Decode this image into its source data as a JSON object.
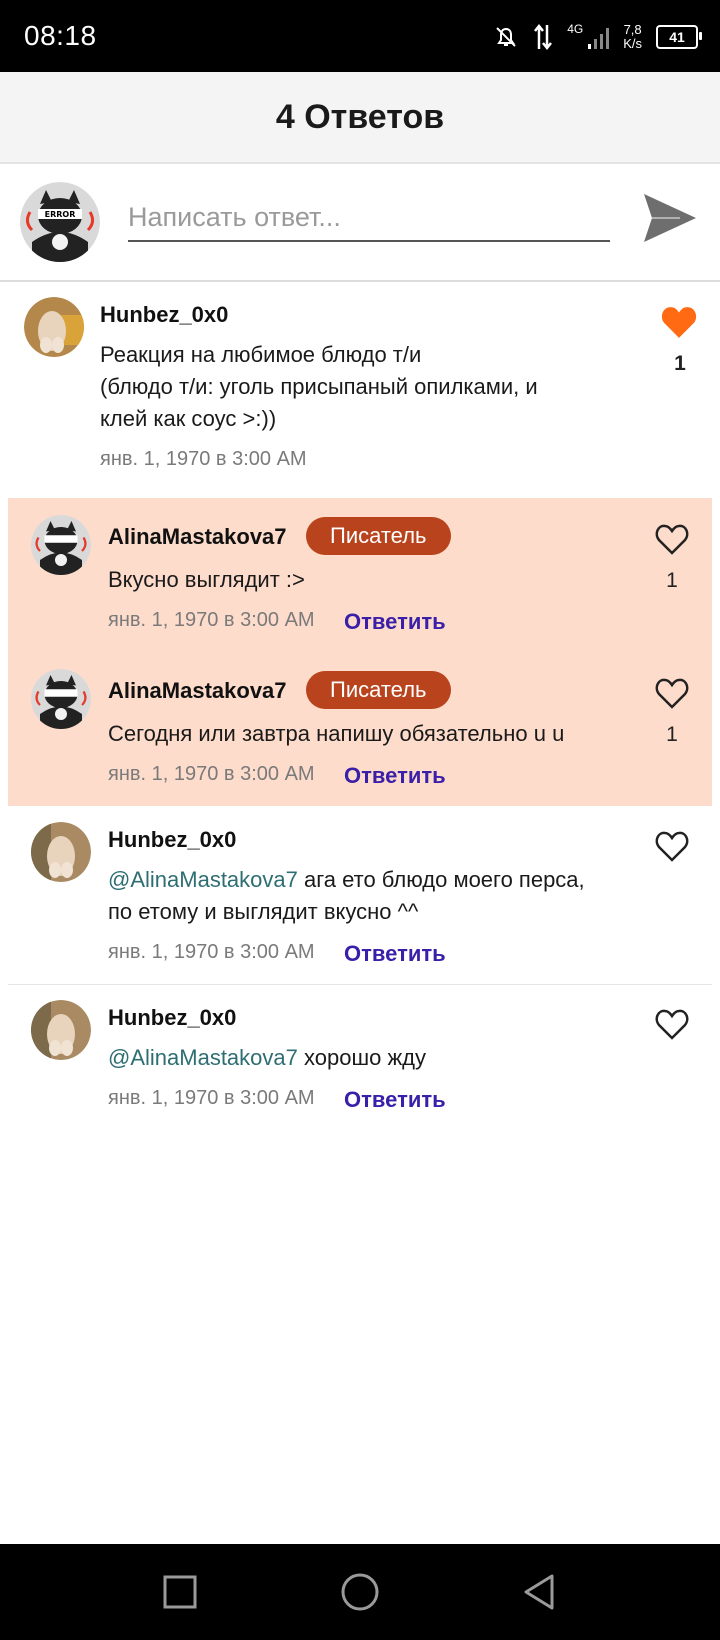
{
  "status_bar": {
    "time": "08:18",
    "network": "4G",
    "speed_value": "7,8",
    "speed_unit": "K/s",
    "battery": "41"
  },
  "header": {
    "title": "4 Ответов"
  },
  "composer": {
    "placeholder": "Написать ответ..."
  },
  "comments": [
    {
      "username": "Hunbez_0x0",
      "text_line1": "Реакция на любимое блюдо т/и",
      "text_line2": "(блюдо т/и: уголь присыпаный опилками, и",
      "text_line3": "клей как соус >:))",
      "date": "янв. 1, 1970 в 3:00 AM",
      "likes": "1",
      "liked": true
    },
    {
      "username": "AlinaMastakova7",
      "badge": "Писатель",
      "text": "Вкусно выглядит :>",
      "date": "янв. 1, 1970 в 3:00 AM",
      "reply_label": "Ответить",
      "likes": "1"
    },
    {
      "username": "AlinaMastakova7",
      "badge": "Писатель",
      "text": "Сегодня или завтра напишу обязательно u u",
      "date": "янв. 1, 1970 в 3:00 AM",
      "reply_label": "Ответить",
      "likes": "1"
    },
    {
      "username": "Hunbez_0x0",
      "mention": "@AlinaMastakova7",
      "text_line1_rest": " ага ето блюдо моего перса,",
      "text_line2": "по етому и выглядит вкусно ^^",
      "date": "янв. 1, 1970 в 3:00 AM",
      "reply_label": "Ответить"
    },
    {
      "username": "Hunbez_0x0",
      "mention": "@AlinaMastakova7",
      "text_rest": " хорошо жду",
      "date": "янв. 1, 1970 в 3:00 AM",
      "reply_label": "Ответить"
    }
  ],
  "colors": {
    "accent_like": "#ff6a13",
    "badge": "#b8431c",
    "reply_link": "#3a1fa8",
    "mention": "#2e6e73",
    "highlight": "#fddccb"
  },
  "icons": {
    "send": "send-icon",
    "like": "heart-icon",
    "nav_recent": "square-icon",
    "nav_home": "circle-icon",
    "nav_back": "triangle-back-icon"
  }
}
